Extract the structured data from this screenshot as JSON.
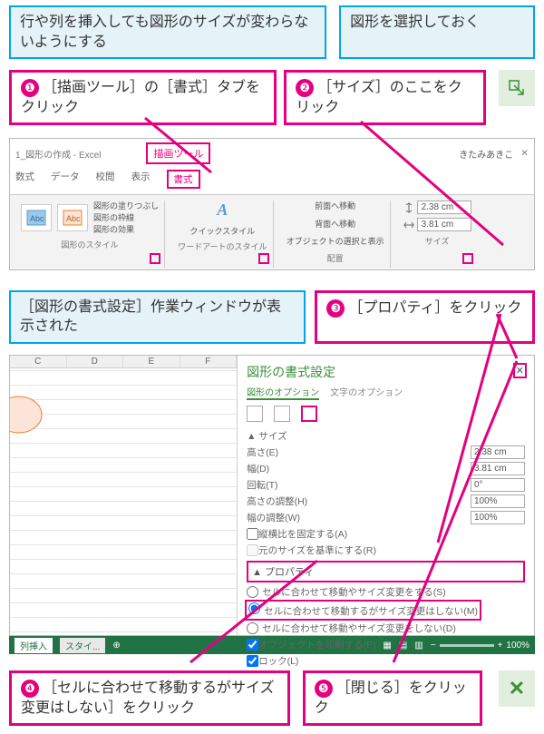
{
  "callouts": {
    "top_left": "行や列を挿入しても図形のサイズが変わらないようにする",
    "top_right": "図形を選択しておく",
    "step1": "［描画ツール］の［書式］タブをクリック",
    "step2": "［サイズ］のここをクリック",
    "mid_left": "［図形の書式設定］作業ウィンドウが表示された",
    "step3": "［プロパティ］をクリック",
    "step4": "［セルに合わせて移動するがサイズ変更はしない］をクリック",
    "step5": "［閉じる］をクリック"
  },
  "ribbon": {
    "filename": "1_図形の作成 - Excel",
    "tool_tab": "描画ツール",
    "user": "きたみあきこ",
    "tabs": [
      "数式",
      "データ",
      "校閲",
      "表示"
    ],
    "active_tab": "書式",
    "groups": {
      "style": "図形のスタイル",
      "wordart": "ワードアートのスタイル",
      "arrange": "配置",
      "size": "サイズ"
    },
    "style_items": [
      "図形の塗りつぶし",
      "図形の枠線",
      "図形の効果"
    ],
    "arrange_items": [
      "前面へ移動",
      "背面へ移動",
      "オブジェクトの選択と表示"
    ],
    "size_h": "2.38 cm",
    "size_w": "3.81 cm",
    "quick_style": "クイックスタイル"
  },
  "sheet": {
    "cols": [
      "C",
      "D",
      "E",
      "F"
    ]
  },
  "pane": {
    "title": "図形の書式設定",
    "tab_shape": "図形のオプション",
    "tab_text": "文字のオプション",
    "sec_size": "サイズ",
    "rows": {
      "height": "高さ(E)",
      "width": "幅(D)",
      "rotate": "回転(T)",
      "hscale": "高さの調整(H)",
      "wscale": "幅の調整(W)"
    },
    "vals": {
      "h": "2.38 cm",
      "w": "3.81 cm",
      "r": "0°",
      "hs": "100%",
      "ws": "100%"
    },
    "lock_aspect": "縦横比を固定する(A)",
    "rel_original": "元のサイズを基準にする(R)",
    "sec_prop": "プロパティ",
    "radios": {
      "a": "セルに合わせて移動やサイズ変更をする(S)",
      "b": "セルに合わせて移動するがサイズ変更はしない(M)",
      "c": "セルに合わせて移動やサイズ変更をしない(D)"
    },
    "print": "オブジェクトを印刷する(P)",
    "lock": "ロック(L)"
  },
  "status": {
    "tab1": "列挿入",
    "tab2": "スタイ...",
    "zoom": "100%"
  }
}
